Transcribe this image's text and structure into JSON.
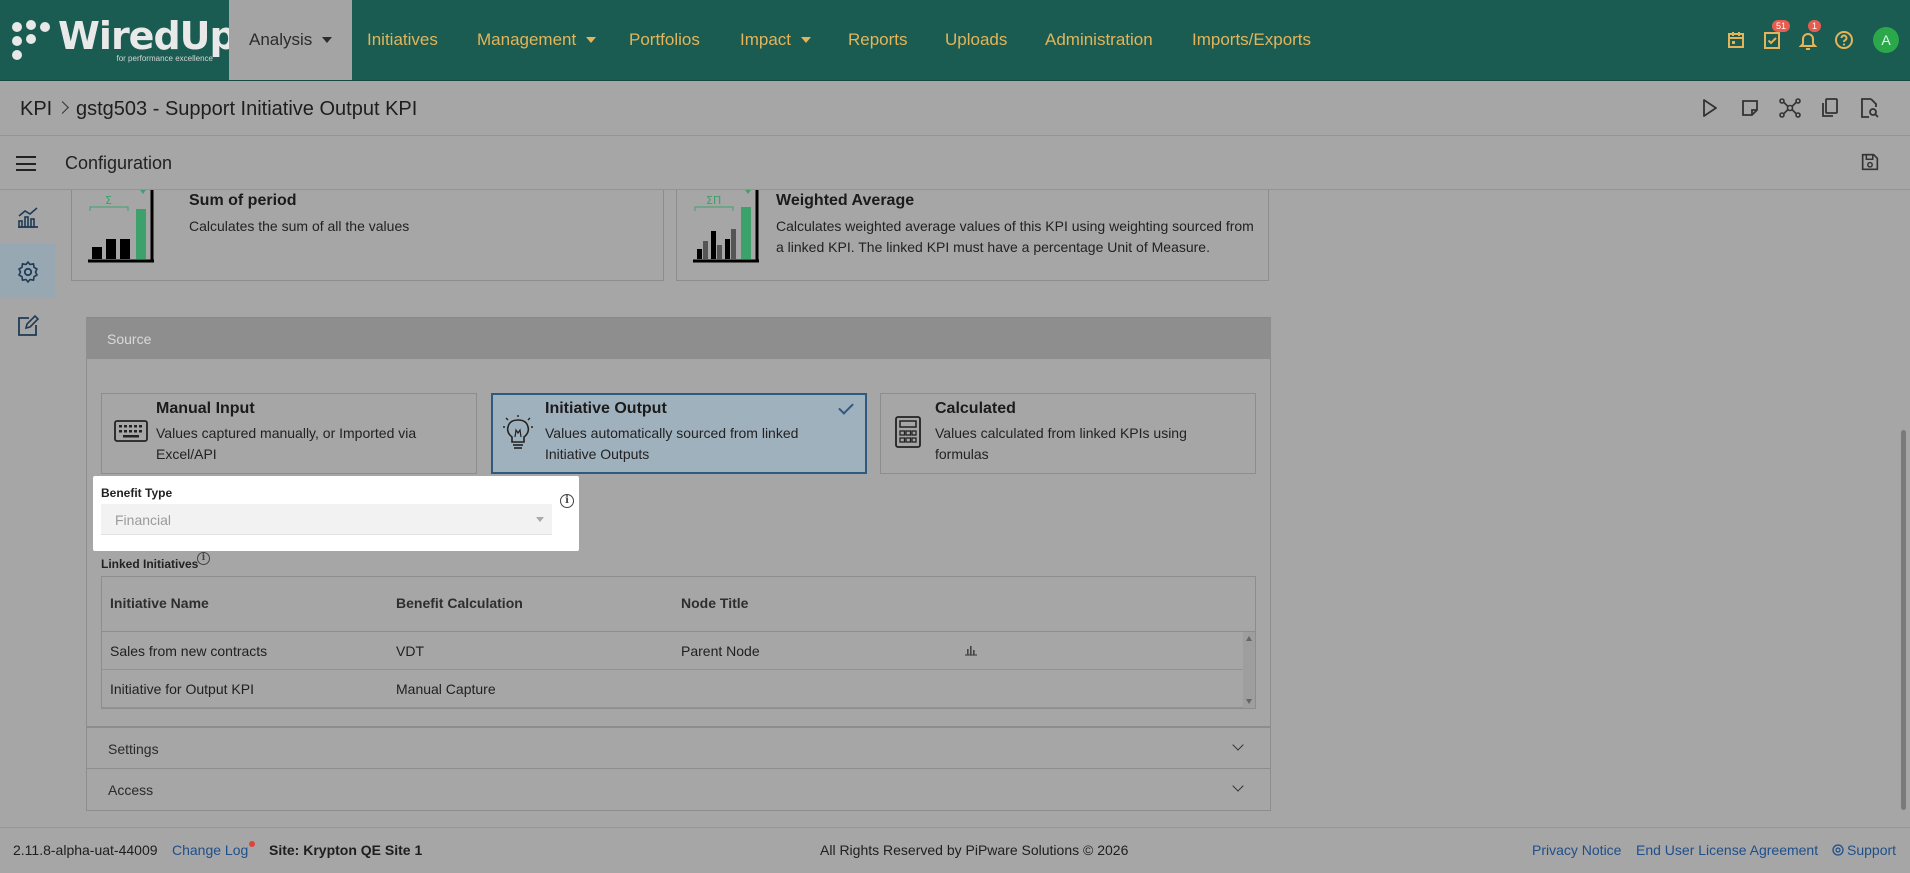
{
  "brand": {
    "name": "WiredUp",
    "tagline": "for performance excellence"
  },
  "nav": {
    "items": [
      {
        "label": "Analysis",
        "active": true,
        "dropdown": true
      },
      {
        "label": "Initiatives"
      },
      {
        "label": "Management",
        "dropdown": true
      },
      {
        "label": "Portfolios"
      },
      {
        "label": "Impact",
        "dropdown": true
      },
      {
        "label": "Reports"
      },
      {
        "label": "Uploads"
      },
      {
        "label": "Administration"
      },
      {
        "label": "Imports/Exports"
      }
    ],
    "icons": [
      {
        "name": "calendar-icon"
      },
      {
        "name": "tasks-icon",
        "badge": "51"
      },
      {
        "name": "bell-icon",
        "badge": "1"
      },
      {
        "name": "help-icon"
      }
    ],
    "avatar": "A"
  },
  "breadcrumb": {
    "root": "KPI",
    "current": "gstg503 - Support Initiative Output KPI"
  },
  "page": {
    "section_title": "Configuration"
  },
  "aggregation": [
    {
      "title": "Sum of period",
      "desc": "Calculates the sum of all the values",
      "icon_label": "Σ"
    },
    {
      "title": "Weighted Average",
      "desc": "Calculates weighted average values of this KPI using weighting sourced from a linked KPI. The linked KPI must have a percentage Unit of Measure.",
      "icon_label": "ΣΠ"
    }
  ],
  "source": {
    "header": "Source",
    "options": [
      {
        "title": "Manual Input",
        "desc": "Values captured manually, or Imported via Excel/API",
        "icon": "keyboard-icon"
      },
      {
        "title": "Initiative Output",
        "desc": "Values automatically sourced from linked Initiative Outputs",
        "icon": "lightbulb-icon",
        "selected": true
      },
      {
        "title": "Calculated",
        "desc": "Values calculated from linked KPIs using formulas",
        "icon": "calculator-icon"
      }
    ]
  },
  "benefit_type": {
    "label": "Benefit Type",
    "value": "Financial"
  },
  "linked_initiatives": {
    "label": "Linked Initiatives",
    "columns": [
      "Initiative Name",
      "Benefit Calculation",
      "Node Title"
    ],
    "rows": [
      {
        "name": "Sales from new contracts",
        "calc": "VDT",
        "node": "Parent Node",
        "has_chart": true
      },
      {
        "name": "Initiative for Output KPI",
        "calc": "Manual Capture",
        "node": "",
        "has_chart": false
      }
    ]
  },
  "sections": {
    "settings": "Settings",
    "access": "Access"
  },
  "footer": {
    "version": "2.11.8-alpha-uat-44009",
    "changelog": "Change Log",
    "site": "Site: Krypton QE Site 1",
    "copyright": "All Rights Reserved by PiPware Solutions © 2026",
    "privacy": "Privacy Notice",
    "eula": "End User License Agreement",
    "support": "Support"
  }
}
